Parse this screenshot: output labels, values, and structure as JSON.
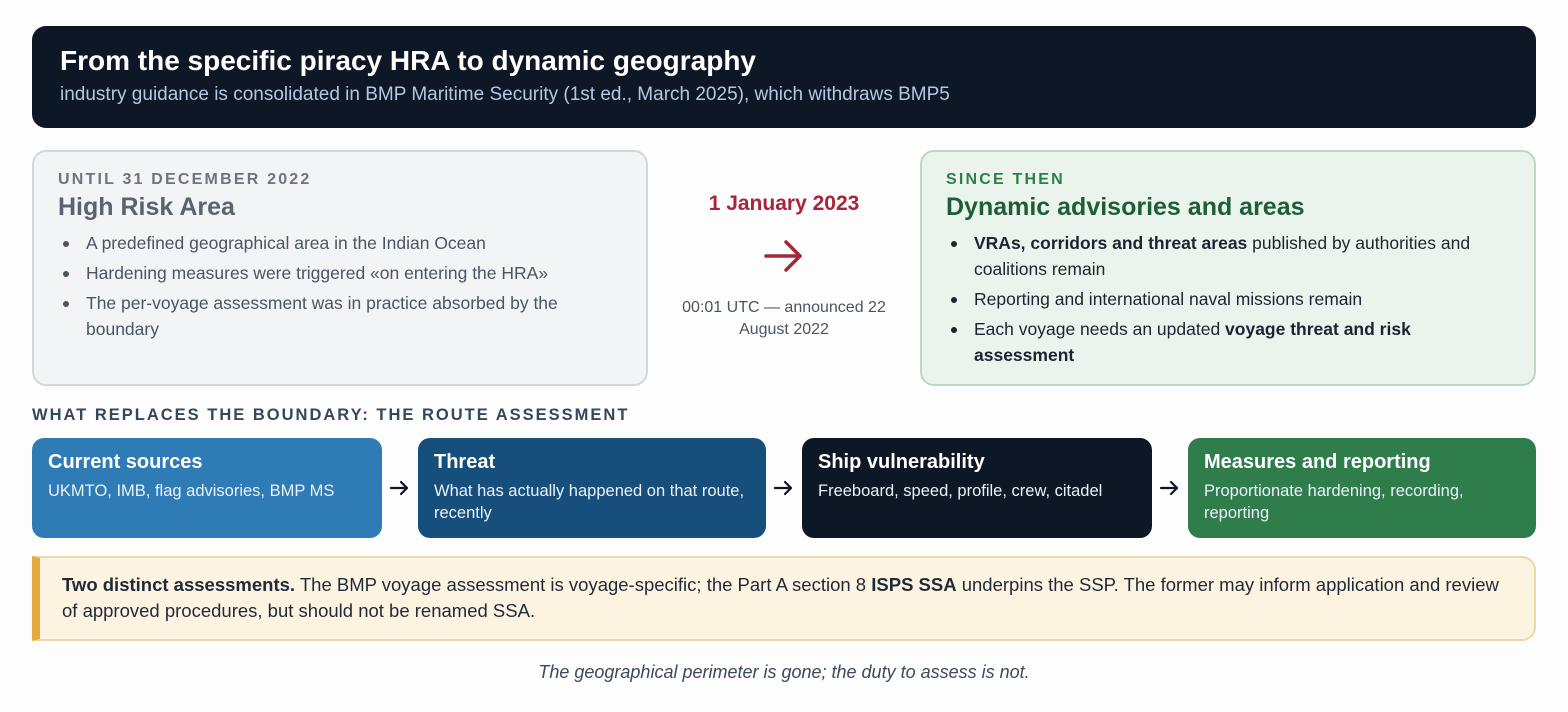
{
  "header": {
    "title": "From the specific piracy HRA to dynamic geography",
    "subtitle": "industry guidance is consolidated in BMP Maritime Security (1st ed., March 2025), which withdraws BMP5"
  },
  "before": {
    "kicker": "UNTIL 31 DECEMBER 2022",
    "title": "High Risk Area",
    "items": [
      "A predefined geographical area in the Indian Ocean",
      "Hardening measures were triggered «on entering the HRA»",
      "The per-voyage assessment was in practice absorbed by the boundary"
    ]
  },
  "transition": {
    "date": "1 January 2023",
    "note": "00:01 UTC — announced 22 August 2022"
  },
  "after": {
    "kicker": "SINCE THEN",
    "title": "Dynamic advisories and areas",
    "item1_bold": "VRAs, corridors and threat areas",
    "item1_rest": " published by authorities and coalitions remain",
    "item2": "Reporting and international naval missions remain",
    "item3_start": "Each voyage needs an updated ",
    "item3_bold": "voyage threat and risk assessment"
  },
  "process": {
    "title": "WHAT REPLACES THE BOUNDARY: THE ROUTE ASSESSMENT",
    "steps": [
      {
        "title": "Current sources",
        "text": "UKMTO, IMB, flag advisories, BMP MS"
      },
      {
        "title": "Threat",
        "text": "What has actually happened on that route, recently"
      },
      {
        "title": "Ship vulnerability",
        "text": "Freeboard, speed, profile, crew, citadel"
      },
      {
        "title": "Measures and reporting",
        "text": "Proportionate hardening, recording, reporting"
      }
    ]
  },
  "callout": {
    "lead": "Two distinct assessments.",
    "part1": " The BMP voyage assessment is voyage-specific; the Part A section 8 ",
    "bold2": "ISPS SSA",
    "part2": " underpins the SSP. The former may inform application and review of approved procedures, but should not be renamed SSA."
  },
  "footer": "The geographical perimeter is gone; the duty to assess is not.",
  "colors": {
    "header_bg": "#0e1726",
    "date_red": "#a8243a",
    "step1": "#2f7bb6",
    "step2": "#164f7c",
    "step3": "#0e1726",
    "step4": "#2e7d4b",
    "callout_accent": "#e6a940"
  }
}
